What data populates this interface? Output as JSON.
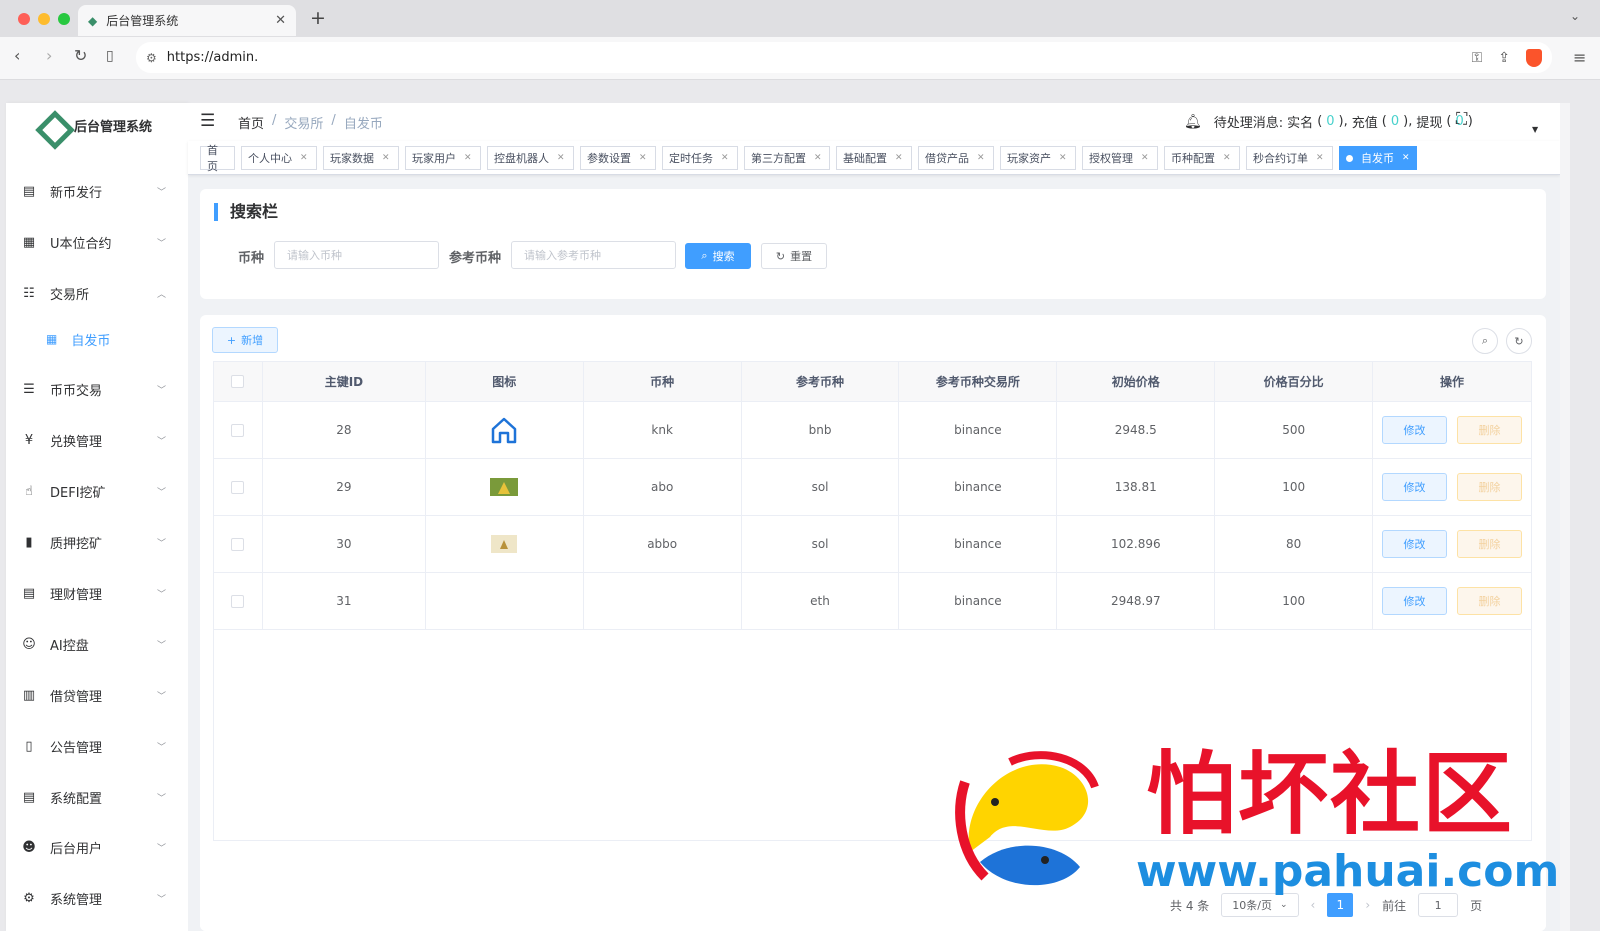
{
  "browser": {
    "tab_title": "后台管理系统",
    "url": "https://admin."
  },
  "app": {
    "name": "后台管理系统"
  },
  "sidebar": {
    "items": [
      {
        "label": "新币发行",
        "icon": "document-icon"
      },
      {
        "label": "U本位合约",
        "icon": "grid-icon"
      },
      {
        "label": "交易所",
        "icon": "list-tree-icon",
        "expanded": true
      },
      {
        "label": "币币交易",
        "icon": "list-icon"
      },
      {
        "label": "兑换管理",
        "icon": "yen-icon"
      },
      {
        "label": "DEFI挖矿",
        "icon": "hand-icon"
      },
      {
        "label": "质押挖矿",
        "icon": "bar-chart-icon"
      },
      {
        "label": "理财管理",
        "icon": "file-icon"
      },
      {
        "label": "AI控盘",
        "icon": "robot-icon"
      },
      {
        "label": "借贷管理",
        "icon": "book-icon"
      },
      {
        "label": "公告管理",
        "icon": "open-book-icon"
      },
      {
        "label": "系统配置",
        "icon": "file-icon"
      },
      {
        "label": "后台用户",
        "icon": "users-icon"
      },
      {
        "label": "系统管理",
        "icon": "gear-icon"
      }
    ],
    "subitem": {
      "label": "自发币",
      "icon": "table-icon"
    }
  },
  "header": {
    "breadcrumb": [
      "首页",
      "交易所",
      "自发币"
    ],
    "notice_label": "待处理消息:",
    "notice_realname": "实名",
    "notice_realname_count": "0",
    "notice_recharge": "充值",
    "notice_recharge_count": "0",
    "notice_withdraw": "提现",
    "notice_withdraw_count": "0"
  },
  "tags": [
    "首页",
    "个人中心",
    "玩家数据",
    "玩家用户",
    "控盘机器人",
    "参数设置",
    "定时任务",
    "第三方配置",
    "基础配置",
    "借贷产品",
    "玩家资产",
    "授权管理",
    "币种配置",
    "秒合约订单",
    "自发币"
  ],
  "search": {
    "title": "搜索栏",
    "coin_label": "币种",
    "coin_placeholder": "请输入币种",
    "ref_label": "参考币种",
    "ref_placeholder": "请输入参考币种",
    "search_btn": "搜索",
    "reset_btn": "重置"
  },
  "table": {
    "add_btn": "新增",
    "columns": [
      "主键ID",
      "图标",
      "币种",
      "参考币种",
      "参考币种交易所",
      "初始价格",
      "价格百分比",
      "操作"
    ],
    "rows": [
      {
        "id": "28",
        "icon": "house-icon",
        "coin": "knk",
        "ref": "bnb",
        "exchange": "binance",
        "price": "2948.5",
        "percent": "500"
      },
      {
        "id": "29",
        "icon": "image-icon",
        "coin": "abo",
        "ref": "sol",
        "exchange": "binance",
        "price": "138.81",
        "percent": "100"
      },
      {
        "id": "30",
        "icon": "image-small-icon",
        "coin": "abbo",
        "ref": "sol",
        "exchange": "binance",
        "price": "102.896",
        "percent": "80"
      },
      {
        "id": "31",
        "icon": "",
        "coin": "",
        "ref": "eth",
        "exchange": "binance",
        "price": "2948.97",
        "percent": "100"
      }
    ],
    "edit_btn": "修改",
    "delete_btn": "删除"
  },
  "pager": {
    "total": "共 4 条",
    "size": "10条/页",
    "current": "1",
    "goto_label": "前往",
    "goto_value": "1",
    "page_unit": "页"
  },
  "watermark": {
    "text": "怕坏社区",
    "url": "www.pahuai.com"
  },
  "colors": {
    "primary": "#409eff",
    "logo": "#3a8f6a",
    "watermark_red": "#e8122a",
    "watermark_blue": "#1d8ee0"
  }
}
